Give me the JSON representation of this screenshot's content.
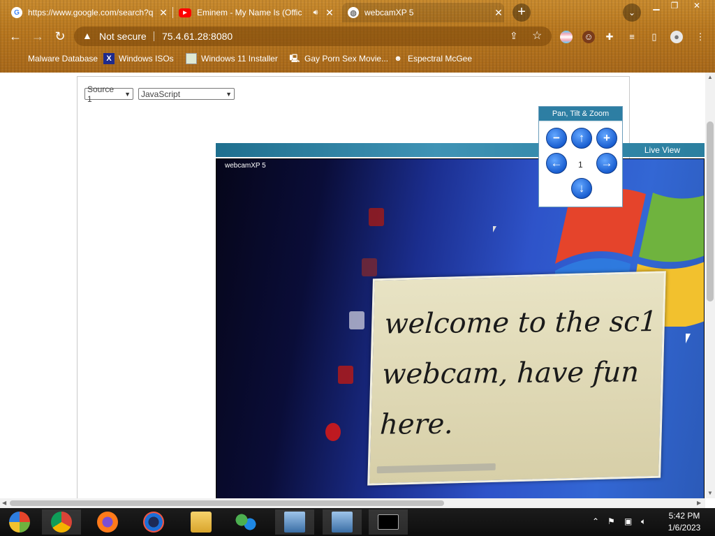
{
  "browser": {
    "tabs": [
      {
        "title": "https://www.google.com/search?q",
        "favicon": "google-g",
        "active": false
      },
      {
        "title": "Eminem - My Name Is (Offic",
        "favicon": "youtube",
        "audio": true,
        "active": false
      },
      {
        "title": "webcamXP 5",
        "favicon": "globe",
        "active": true
      }
    ],
    "new_tab": "+",
    "address": {
      "security": "Not secure",
      "url": "75.4.61.28:8080"
    },
    "bookmarks": [
      {
        "label": "Malware Database",
        "icon": "folder-image-icon"
      },
      {
        "label": "Windows ISOs",
        "icon": "x-icon"
      },
      {
        "label": "Windows 11 Installer",
        "icon": "image-icon"
      },
      {
        "label": "Gay Porn Sex Movie...",
        "icon": "computer-icon"
      },
      {
        "label": "Espectral McGee",
        "icon": "avatar-icon"
      }
    ]
  },
  "page": {
    "source_select": "Source 1",
    "mode_select": "JavaScript",
    "live_view_label": "Live View",
    "camera_label": "webcamXP 5",
    "camera_note": [
      "welcome to the sc1",
      "webcam, have fun",
      "here."
    ],
    "ptz": {
      "title": "Pan, Tilt & Zoom",
      "preset": "1"
    }
  },
  "taskbar": {
    "apps": [
      "windows-start",
      "chrome",
      "firefox",
      "opera",
      "file-explorer",
      "network",
      "remote-desktop-1",
      "remote-desktop-2",
      "command-prompt"
    ],
    "time": "5:42 PM",
    "date": "1/6/2023"
  }
}
